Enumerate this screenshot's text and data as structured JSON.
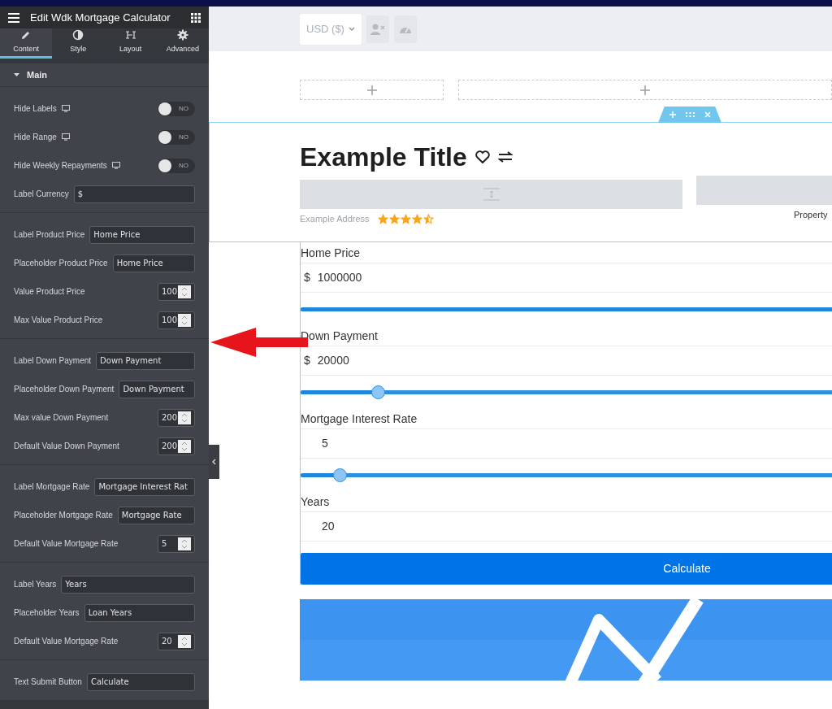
{
  "editor": {
    "title": "Edit Wdk Mortgage Calculator",
    "tabs": [
      {
        "label": "Content",
        "selected": true
      },
      {
        "label": "Style",
        "selected": false
      },
      {
        "label": "Layout",
        "selected": false
      },
      {
        "label": "Advanced",
        "selected": false
      }
    ],
    "section": {
      "title": "Main",
      "expanded": true
    },
    "groups": [
      [
        {
          "kind": "toggle",
          "label": "Hide Labels",
          "on": false,
          "state_text": "NO"
        },
        {
          "kind": "toggle",
          "label": "Hide Range",
          "on": false,
          "state_text": "NO"
        },
        {
          "kind": "toggle",
          "label": "Hide Weekly Repayments",
          "on": false,
          "state_text": "NO"
        },
        {
          "kind": "text",
          "label": "Label Currency",
          "value": "$"
        }
      ],
      [
        {
          "kind": "text",
          "label": "Label Product Price",
          "value": "Home Price"
        },
        {
          "kind": "text",
          "label": "Placeholder Product Price",
          "value": "Home Price"
        },
        {
          "kind": "number",
          "label": "Value Product Price",
          "value": "100"
        },
        {
          "kind": "number",
          "label": "Max Value Product Price",
          "value": "100"
        }
      ],
      [
        {
          "kind": "text",
          "label": "Label Down Payment",
          "value": "Down Payment"
        },
        {
          "kind": "text",
          "label": "Placeholder Down Payment",
          "value": "Down Payment"
        },
        {
          "kind": "number",
          "label": "Max value Down Payment",
          "value": "200"
        },
        {
          "kind": "number",
          "label": "Default Value Down Payment",
          "value": "200"
        }
      ],
      [
        {
          "kind": "text",
          "label": "Label Mortgage Rate",
          "value": "Mortgage Interest Rat"
        },
        {
          "kind": "text",
          "label": "Placeholder Mortgage Rate",
          "value": "Mortgage Rate"
        },
        {
          "kind": "number",
          "label": "Default Value Mortgage Rate",
          "value": "5"
        }
      ],
      [
        {
          "kind": "text",
          "label": "Label Years",
          "value": "Years"
        },
        {
          "kind": "text",
          "label": "Placeholder Years",
          "value": "Loan Years"
        },
        {
          "kind": "number",
          "label": "Default Value Mortgage Rate",
          "value": "20"
        }
      ],
      [
        {
          "kind": "text",
          "label": "Text Submit Button",
          "value": "Calculate"
        }
      ]
    ]
  },
  "canvas": {
    "currency": "USD ($)",
    "title": "Example Title",
    "address": "Example Address",
    "stars": 4.5,
    "side_label": "Property",
    "fields": [
      {
        "label": "Home Price",
        "prefix": "$",
        "value": "1000000",
        "level": 1
      },
      {
        "label": "Down Payment",
        "prefix": "$",
        "value": "20000",
        "level": 0.1
      },
      {
        "label": "Mortgage Interest Rate",
        "value": "5",
        "level": 0.05
      },
      {
        "label": "Years",
        "value": "20"
      }
    ],
    "button": "Calculate"
  }
}
